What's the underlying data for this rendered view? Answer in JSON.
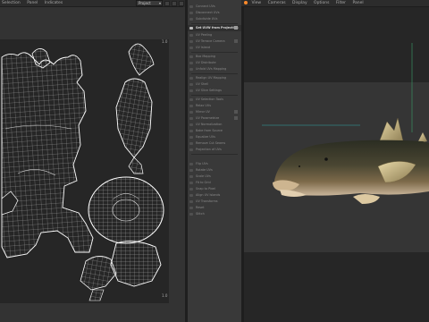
{
  "left_menubar": {
    "items": [
      "Selection",
      "Panel",
      "Indicates"
    ]
  },
  "uv_toolbar": {
    "select_value": "Project"
  },
  "uv_view": {
    "tick_top": "1.0",
    "tick_bottom": "1.0"
  },
  "tools": {
    "items": [
      "Connect UVs",
      "Disconnect UVs",
      "Subdivide UVs",
      "Set UVW from Projection",
      "UV Peeling",
      "UV Terrace Camera",
      "UV Island",
      "Box Mapping",
      "UV Distribute",
      "Unfold UVs Mapping",
      "Realign UV Mapping",
      "UV Shell",
      "UV Slice Settings",
      "UV Selection Tools",
      "Relax UVs",
      "Mirror UV",
      "UV Parametrize",
      "UV Normalization",
      "Bake from Source",
      "Equalize UVs",
      "Remove Cut Seams",
      "Projection of UVs",
      "Flip UVs",
      "Rotate UVs",
      "Scale UVs",
      "Fit to Grid",
      "Snap to Pixel",
      "Align UV Islands",
      "UV Transforms",
      "Reset",
      "Stitch"
    ]
  },
  "right_menubar": {
    "items": [
      "View",
      "Cameras",
      "Display",
      "Options",
      "Filter",
      "Panel"
    ]
  },
  "colors": {
    "accent": "#ff8a2a",
    "uv_wire": "#dadada",
    "uv_boundary": "#ffffff"
  }
}
